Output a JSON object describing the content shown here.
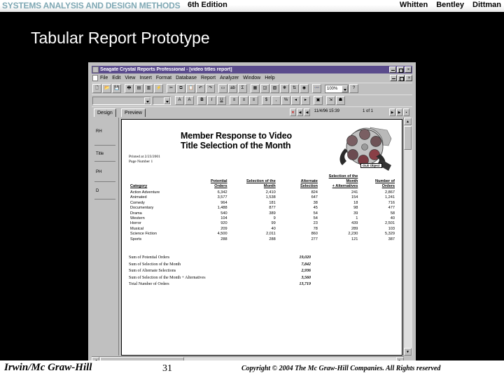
{
  "banner": {
    "title": "SYSTEMS ANALYSIS AND DESIGN METHODS",
    "edition": "6th Edition",
    "authors": [
      "Whitten",
      "Bentley",
      "Dittman"
    ]
  },
  "slide": {
    "title": "Tabular Report Prototype"
  },
  "footer": {
    "publisher": "Irwin/Mc Graw-Hill",
    "page_number": "31",
    "copyright": "Copyright © 2004 The Mc Graw-Hill Companies. All Rights reserved"
  },
  "app": {
    "title": "Seagate Crystal Reports Professional - [video titles report]",
    "menu": [
      "File",
      "Edit",
      "View",
      "Insert",
      "Format",
      "Database",
      "Report",
      "Analyzer",
      "Window",
      "Help"
    ],
    "zoom_value": "100%",
    "tabs": [
      {
        "label": "Design"
      },
      {
        "label": "Preview"
      }
    ],
    "status": {
      "date": "11/4/96 15:39",
      "page_of": "1 of 1"
    },
    "sections": [
      "RH",
      "Title",
      "PH",
      "D"
    ],
    "window_buttons": [
      "minimize",
      "maximize",
      "close"
    ],
    "toolbar1_icons": [
      "new-document-icon",
      "open-folder-icon",
      "save-disk-icon",
      "print-icon",
      "print-preview-icon",
      "export-icon",
      "refresh-icon",
      "cut-icon",
      "copy-icon",
      "paste-icon",
      "undo-icon",
      "redo-icon",
      "insert-field-icon",
      "insert-text-icon",
      "insert-summary-icon",
      "insert-chart-icon",
      "insert-map-icon",
      "insert-picture-icon",
      "select-expert-icon",
      "sort-order-icon",
      "highlight-icon",
      "search-binoculars-icon"
    ],
    "toolbar2_icons": [
      "font-color-icon",
      "font-size-icon",
      "bold-icon",
      "italic-icon",
      "underline-icon",
      "align-left-icon",
      "align-center-icon",
      "align-right-icon",
      "currency-icon",
      "comma-icon",
      "percent-icon",
      "increase-decimal-icon",
      "decrease-decimal-icon",
      "border-icon",
      "group-icon",
      "expert-icon"
    ]
  },
  "report": {
    "title_line1": "Member Response to Video",
    "title_line2": "Title Selection of the Month",
    "printed_at": "Printed at 2/23/2001",
    "page_number": "Page Number 1",
    "reel_label": "OLE Object",
    "columns": [
      "Category",
      "Potential Orders",
      "Selection of the Month",
      "Alternate Selection",
      "Selection of the Month + Alternatives",
      "Number of Orders"
    ],
    "column_header_lines": [
      [
        "Category",
        ""
      ],
      [
        "Potential",
        "Orders"
      ],
      [
        "Selection of the",
        "Month"
      ],
      [
        "Alternate",
        "Selection"
      ],
      [
        "Selection of the Month",
        "+ Alternatives"
      ],
      [
        "Number of",
        "Orders"
      ]
    ],
    "rows": [
      {
        "category": "Action Adventure",
        "potential_orders": "6,342",
        "selection_of_month": "2,410",
        "alternate_selection": "824",
        "month_plus_alternatives": "241",
        "number_of_orders": "2,867"
      },
      {
        "category": "Animated",
        "potential_orders": "3,577",
        "selection_of_month": "1,538",
        "alternate_selection": "647",
        "month_plus_alternatives": "154",
        "number_of_orders": "1,241"
      },
      {
        "category": "Comedy",
        "potential_orders": "964",
        "selection_of_month": "181",
        "alternate_selection": "38",
        "month_plus_alternatives": "18",
        "number_of_orders": "716"
      },
      {
        "category": "Documentary",
        "potential_orders": "1,488",
        "selection_of_month": "877",
        "alternate_selection": "45",
        "month_plus_alternatives": "98",
        "number_of_orders": "477"
      },
      {
        "category": "Drama",
        "potential_orders": "540",
        "selection_of_month": "389",
        "alternate_selection": "54",
        "month_plus_alternatives": "39",
        "number_of_orders": "58"
      },
      {
        "category": "Western",
        "potential_orders": "104",
        "selection_of_month": "9",
        "alternate_selection": "54",
        "month_plus_alternatives": "1",
        "number_of_orders": "40"
      },
      {
        "category": "Horror",
        "potential_orders": "920",
        "selection_of_month": "99",
        "alternate_selection": "23",
        "month_plus_alternatives": "439",
        "number_of_orders": "2,501"
      },
      {
        "category": "Musical",
        "potential_orders": "209",
        "selection_of_month": "40",
        "alternate_selection": "78",
        "month_plus_alternatives": "289",
        "number_of_orders": "103"
      },
      {
        "category": "Science Fiction",
        "potential_orders": "4,500",
        "selection_of_month": "2,011",
        "alternate_selection": "860",
        "month_plus_alternatives": "2,230",
        "number_of_orders": "5,329"
      },
      {
        "category": "Sports",
        "potential_orders": "288",
        "selection_of_month": "288",
        "alternate_selection": "277",
        "month_plus_alternatives": "121",
        "number_of_orders": "387"
      }
    ],
    "totals": [
      {
        "label": "Sum of Potential Orders",
        "value": "19,020"
      },
      {
        "label": "Sum of Selection of the Month",
        "value": "7,842"
      },
      {
        "label": "Sum of Alternate Selections",
        "value": "2,936"
      },
      {
        "label": "Sum of Selection of the Month + Alternatives",
        "value": "3,560"
      },
      {
        "label": "Total Number of Orders",
        "value": "13,719"
      }
    ]
  },
  "colors": {
    "banner_title": "#7fa8b4",
    "slide_background": "#000000",
    "titlebar": "#5a4b8c",
    "chrome": "#c0c0c0"
  }
}
